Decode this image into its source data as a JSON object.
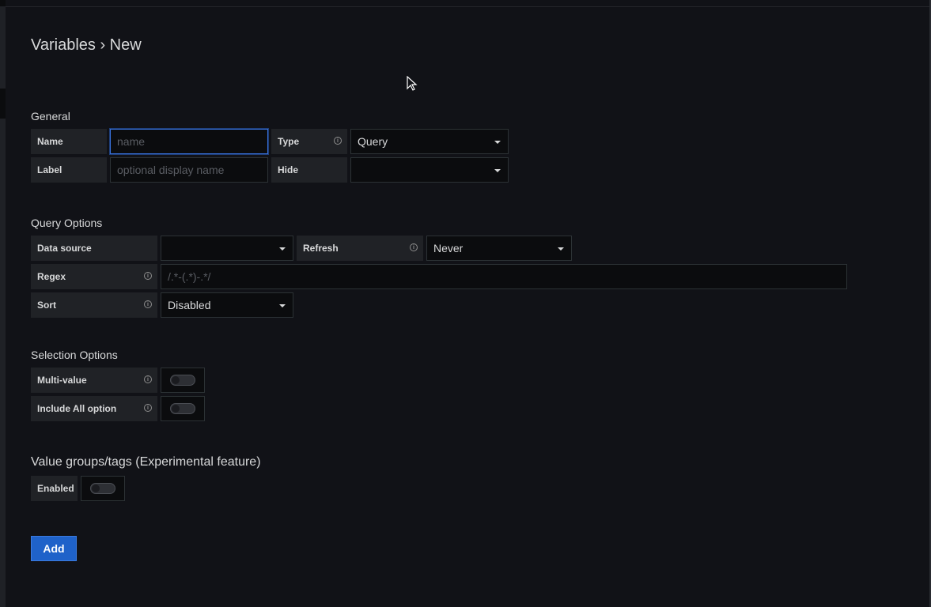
{
  "page": {
    "title": "Variables › New"
  },
  "general": {
    "heading": "General",
    "name_label": "Name",
    "name_placeholder": "name",
    "name_value": "",
    "type_label": "Type",
    "type_value": "Query",
    "label_label": "Label",
    "label_placeholder": "optional display name",
    "label_value": "",
    "hide_label": "Hide",
    "hide_value": ""
  },
  "query_options": {
    "heading": "Query Options",
    "datasource_label": "Data source",
    "datasource_value": "",
    "refresh_label": "Refresh",
    "refresh_value": "Never",
    "regex_label": "Regex",
    "regex_placeholder": "/.*-(.*)-.*/",
    "regex_value": "",
    "sort_label": "Sort",
    "sort_value": "Disabled"
  },
  "selection_options": {
    "heading": "Selection Options",
    "multi_label": "Multi-value",
    "multi_on": false,
    "include_all_label": "Include All option",
    "include_all_on": false
  },
  "value_groups": {
    "heading": "Value groups/tags (Experimental feature)",
    "enabled_label": "Enabled",
    "enabled_on": false
  },
  "actions": {
    "add_label": "Add"
  },
  "icons": {
    "info": "info-circle-icon",
    "caret": "caret-down-icon",
    "cursor": "mouse-pointer-icon"
  },
  "colors": {
    "accent": "#3871dc",
    "button": "#1f62c9",
    "background": "#111217"
  }
}
